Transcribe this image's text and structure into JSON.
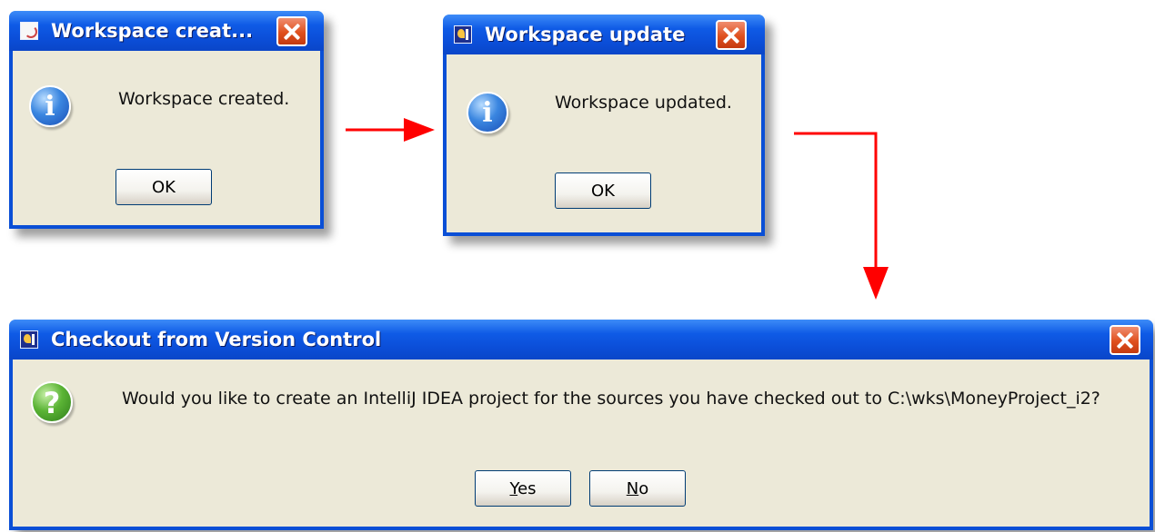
{
  "dialogs": [
    {
      "title": "Workspace creat...",
      "message": "Workspace created.",
      "buttons": [
        "OK"
      ]
    },
    {
      "title": "Workspace update",
      "message": "Workspace updated.",
      "buttons": [
        "OK"
      ]
    },
    {
      "title": "Checkout from Version Control",
      "message": "Would you like to create an IntelliJ IDEA project for the sources you have checked out to C:\\wks\\MoneyProject_i2?",
      "buttons": [
        {
          "mnemonic": "Y",
          "rest": "es"
        },
        {
          "mnemonic": "N",
          "rest": "o"
        }
      ]
    }
  ],
  "colors": {
    "title_bar": "#0a4fd6",
    "dialog_body": "#ece9d8",
    "arrow": "#ff0000"
  },
  "icons": {
    "dialog1_app": "java-icon",
    "dialog2_app": "intellij-icon",
    "dialog3_app": "intellij-icon",
    "dialog1_message": "info-icon",
    "dialog2_message": "info-icon",
    "dialog3_message": "question-icon"
  }
}
